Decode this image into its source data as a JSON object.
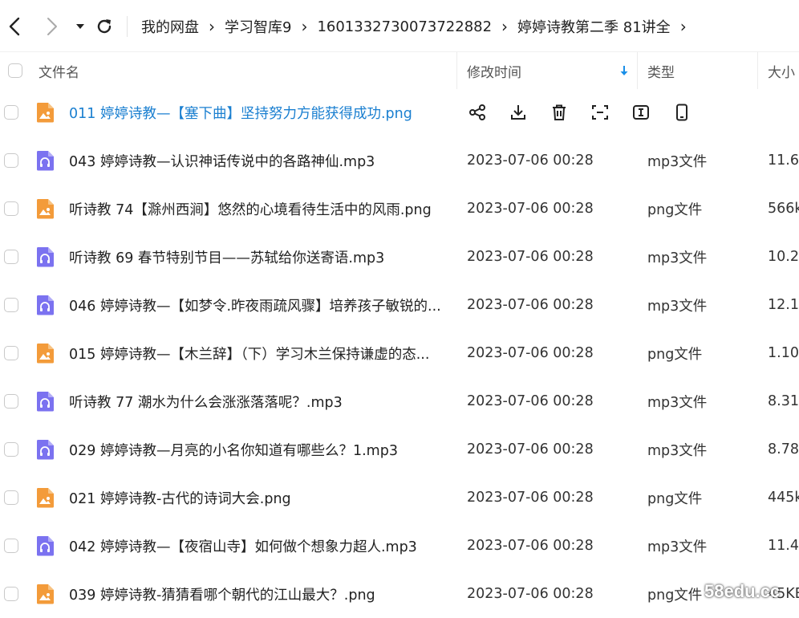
{
  "breadcrumb": [
    "我的网盘",
    "学习智库9",
    "1601332730073722882",
    "婷婷诗教第二季 81讲全"
  ],
  "columns": {
    "name": "文件名",
    "time": "修改时间",
    "type": "类型",
    "size": "大小"
  },
  "rows": [
    {
      "name": "011 婷婷诗教—【塞下曲】坚持努力方能获得成功.png",
      "kind": "image",
      "time": "",
      "type": "",
      "size": "",
      "hovered": true
    },
    {
      "name": "043 婷婷诗教—认识神话传说中的各路神仙.mp3",
      "kind": "audio",
      "time": "2023-07-06 00:28",
      "type": "mp3文件",
      "size": "11.6"
    },
    {
      "name": "听诗教 74【滁州西涧】悠然的心境看待生活中的风雨.png",
      "kind": "image",
      "time": "2023-07-06 00:28",
      "type": "png文件",
      "size": "566k"
    },
    {
      "name": "听诗教 69 春节特别节目——苏轼给你送寄语.mp3",
      "kind": "audio",
      "time": "2023-07-06 00:28",
      "type": "mp3文件",
      "size": "10.2"
    },
    {
      "name": "046 婷婷诗教—【如梦令.昨夜雨疏风骤】培养孩子敏锐的...",
      "kind": "audio",
      "time": "2023-07-06 00:28",
      "type": "mp3文件",
      "size": "12.1"
    },
    {
      "name": "015 婷婷诗教—【木兰辞】（下）学习木兰保持谦虚的态...",
      "kind": "image",
      "time": "2023-07-06 00:28",
      "type": "png文件",
      "size": "1.10"
    },
    {
      "name": "听诗教 77 潮水为什么会涨涨落落呢？.mp3",
      "kind": "audio",
      "time": "2023-07-06 00:28",
      "type": "mp3文件",
      "size": "8.31"
    },
    {
      "name": "029 婷婷诗教—月亮的小名你知道有哪些么？1.mp3",
      "kind": "audio",
      "time": "2023-07-06 00:28",
      "type": "mp3文件",
      "size": "8.78"
    },
    {
      "name": "021 婷婷诗教-古代的诗词大会.png",
      "kind": "image",
      "time": "2023-07-06 00:28",
      "type": "png文件",
      "size": "445k"
    },
    {
      "name": "042 婷婷诗教—【夜宿山寺】如何做个想象力超人.mp3",
      "kind": "audio",
      "time": "2023-07-06 00:28",
      "type": "mp3文件",
      "size": "11.4"
    },
    {
      "name": "039 婷婷诗教-猜猜看哪个朝代的江山最大？.png",
      "kind": "image",
      "time": "2023-07-06 00:28",
      "type": "png文件",
      "size": "45KB"
    }
  ],
  "row_actions": [
    "share-icon",
    "download-icon",
    "delete-icon",
    "scan-icon",
    "text-extract-icon",
    "phone-icon"
  ],
  "watermark": "58edu.cc",
  "colors": {
    "image_icon": "#f39b3a",
    "audio_icon": "#7b72f0",
    "link_blue": "#1a7fd0",
    "sort_arrow": "#1a8fe8"
  },
  "sort": {
    "column": "time",
    "direction": "descending"
  }
}
